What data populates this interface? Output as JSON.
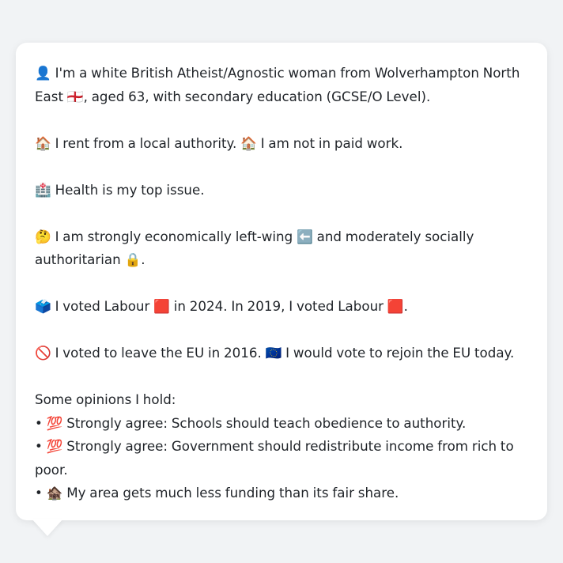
{
  "profile": {
    "identity": "👤 I'm a white British Atheist/Agnostic woman from Wolverhampton North East 🏴󠁧󠁢󠁥󠁮󠁧󠁿, aged 63, with secondary education (GCSE/O Level).",
    "housing": "🏠 I rent from a local authority. 🏠 I am not in paid work.",
    "top_issue": "🏥 Health is my top issue.",
    "ideology": "🤔 I am strongly economically left-wing ⬅️ and moderately socially authoritarian 🔒.",
    "votes": "🗳️ I voted Labour 🟥 in 2024. In 2019, I voted Labour 🟥.",
    "eu": "🚫 I voted to leave the EU in 2016. 🇪🇺 I would vote to rejoin the EU today.",
    "opinions_heading": "Some opinions I hold:",
    "opinions": [
      "• 💯 Strongly agree: Schools should teach obedience to authority.",
      "• 💯 Strongly agree: Government should redistribute income from rich to poor.",
      "• 🏚️ My area gets much less funding than its fair share."
    ]
  }
}
